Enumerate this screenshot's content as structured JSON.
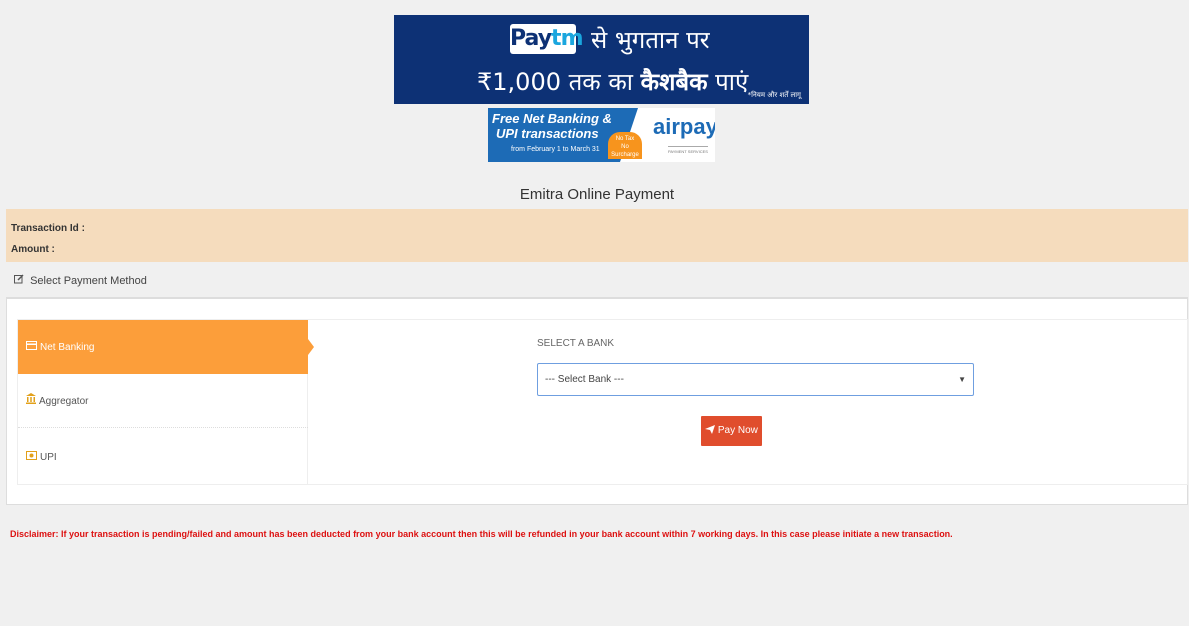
{
  "banners": {
    "paytm": {
      "logo_pay": "Pay",
      "logo_tm": "tm",
      "line1": "से भुगतान पर",
      "line2_amount": "₹1,000",
      "line2_mid": " तक का ",
      "line2_bold": "कैशबैक",
      "line2_end": " पाएं",
      "terms": "*नियम और शर्तें लागू"
    },
    "airpay": {
      "line1": "Free Net Banking &",
      "line2": "UPI transactions",
      "line3": "from February 1 to March 31",
      "badge1": "No Tax",
      "badge2": "No Surcharge",
      "logo": "airpay",
      "logo_sub": "PAYMENT SERVICES"
    }
  },
  "page_title": "Emitra Online Payment",
  "transaction": {
    "id_label": "Transaction Id :",
    "amount_label": "Amount :"
  },
  "payment_method": {
    "header": "Select Payment Method",
    "tabs": [
      {
        "label": "Net Banking",
        "icon": "credit-card-icon",
        "active": true
      },
      {
        "label": "Aggregator",
        "icon": "bank-icon",
        "active": false
      },
      {
        "label": "UPI",
        "icon": "upi-icon",
        "active": false
      }
    ],
    "bank_label": "SELECT A BANK",
    "bank_select_value": "--- Select Bank ---",
    "pay_button": "Pay Now"
  },
  "disclaimer": "Disclaimer: If your transaction is pending/failed and amount has been deducted from your bank account then this will be refunded in your bank account within 7 working days. In this case please initiate a new transaction.",
  "colors": {
    "accent_orange": "#fc9e3a",
    "pay_button": "#e04d2d",
    "info_strip": "#f5dcbd",
    "disclaimer": "#dd1111",
    "paytm_blue": "#0d3175"
  }
}
